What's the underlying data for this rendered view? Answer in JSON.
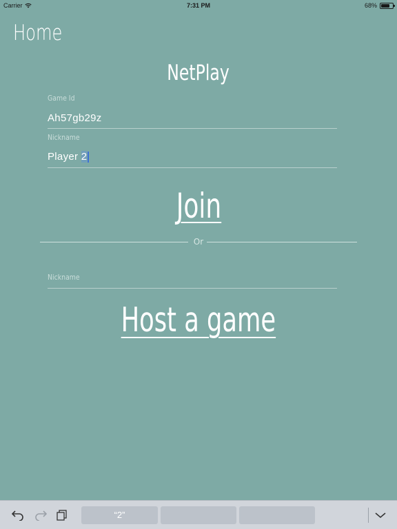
{
  "status_bar": {
    "carrier": "Carrier",
    "time": "7:31 PM",
    "battery": "68%",
    "battery_level": 0.68
  },
  "header": {
    "back_label": "Home",
    "title": "NetPlay"
  },
  "join_form": {
    "game_id": {
      "label": "Game Id",
      "value": "Ah57gb29z"
    },
    "nickname": {
      "label": "Nickname",
      "value_prefix": "Player ",
      "value_selected": "2"
    },
    "join_label": "Join"
  },
  "separator": {
    "label": "Or"
  },
  "host_form": {
    "nickname": {
      "label": "Nickname",
      "value": ""
    },
    "host_label": "Host a game"
  },
  "keyboard_bar": {
    "suggestions": [
      "“2”",
      "",
      ""
    ],
    "icons": [
      "undo-icon",
      "redo-icon",
      "paste-icon",
      "dismiss-keyboard-icon"
    ]
  },
  "colors": {
    "background": "#7eaaa5",
    "text": "#ffffff",
    "keyboard_bar": "#d1d5db"
  }
}
